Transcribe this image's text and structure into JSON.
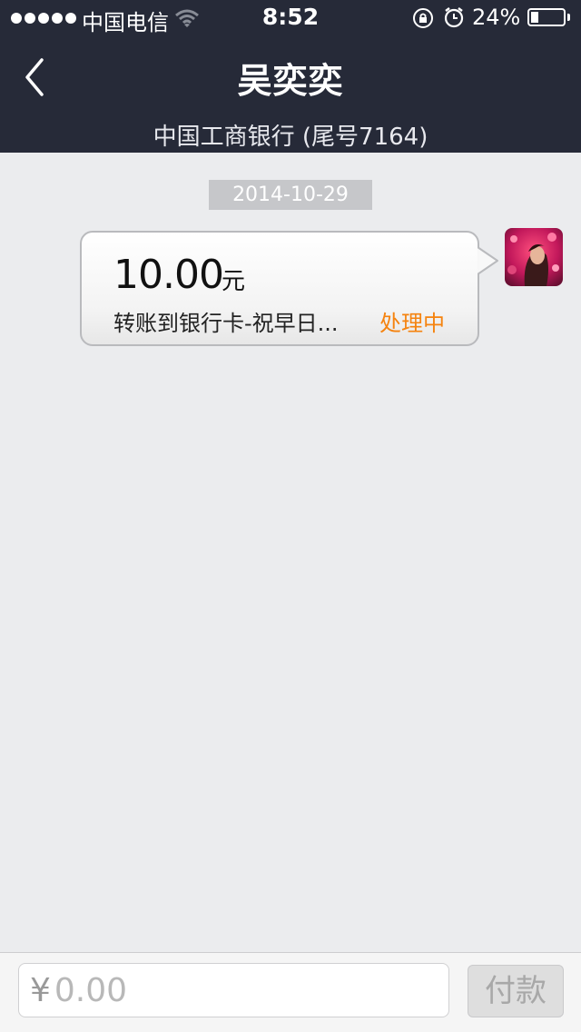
{
  "statusbar": {
    "carrier": "中国电信",
    "time": "8:52",
    "battery_pct": "24%",
    "battery_level": 0.24,
    "icons": [
      "signal-dots",
      "wifi-icon",
      "rotation-lock-icon",
      "alarm-icon",
      "battery-icon"
    ]
  },
  "nav": {
    "title": "吴奕奕",
    "subtitle": "中国工商银行 (尾号7164)",
    "back_icon": "chevron-left-icon"
  },
  "chat": {
    "date": "2014-10-29",
    "message": {
      "amount": "10.00",
      "unit": "元",
      "description": "转账到银行卡-祝早日...",
      "status": "处理中",
      "status_color": "#f5830f"
    }
  },
  "input": {
    "currency": "¥",
    "placeholder": "0.00",
    "pay_label": "付款"
  },
  "colors": {
    "header_bg": "#262a38",
    "page_bg": "#ebecee",
    "accent": "#f5830f"
  }
}
